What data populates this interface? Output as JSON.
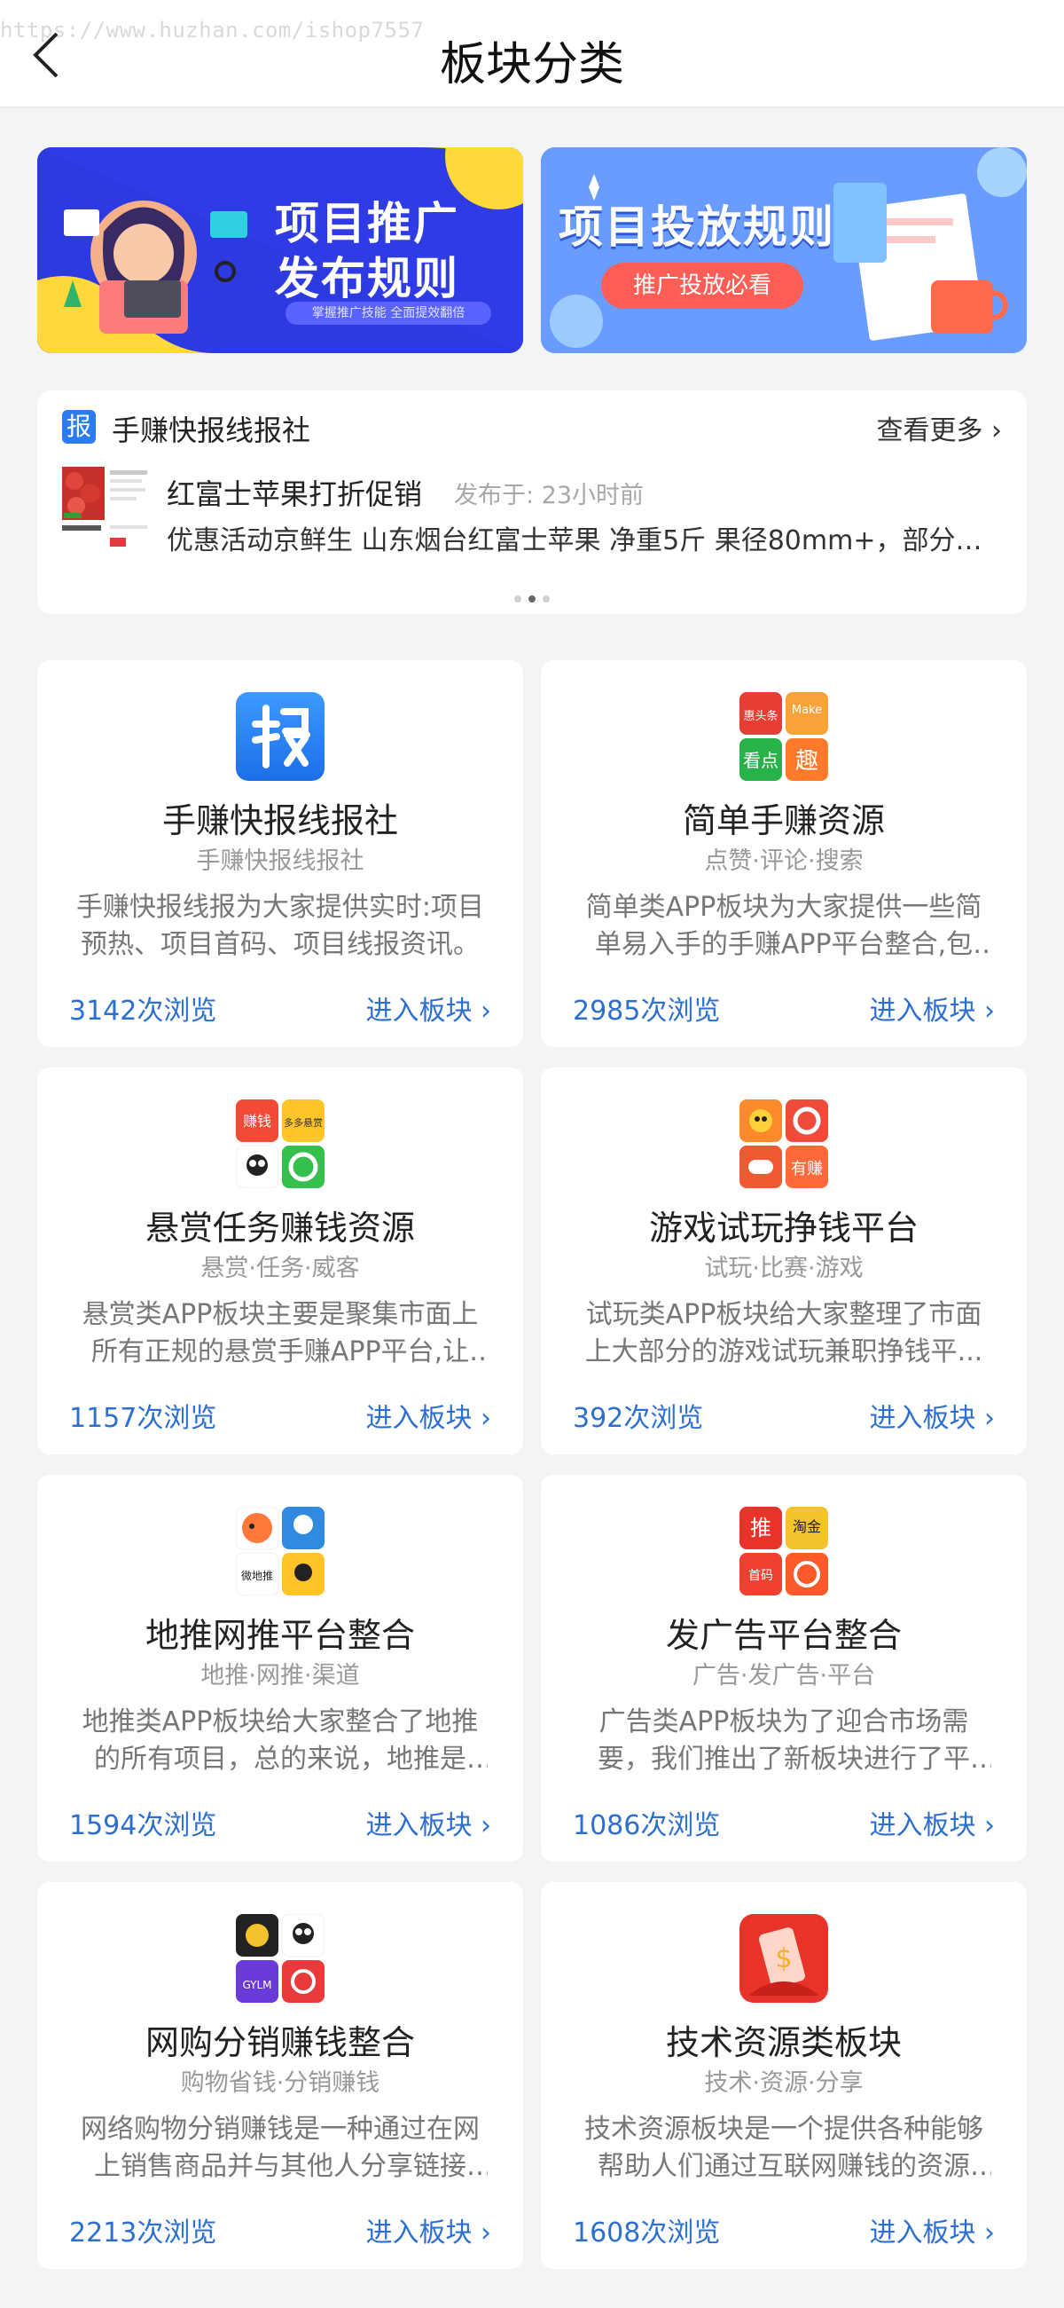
{
  "header": {
    "watermark": "https://www.huzhan.com/ishop7557",
    "title": "板块分类"
  },
  "banners": [
    {
      "title": "项目推广发布规则",
      "line1": "项目推广",
      "line2": "发布规则",
      "tagline": "掌握推广技能 全面提效翻倍"
    },
    {
      "title": "项目投放规则",
      "pill": "推广投放必看"
    }
  ],
  "news": {
    "badge": "报",
    "section_title": "手赚快报线报社",
    "more_label": "查看更多",
    "item": {
      "title": "红富士苹果打折促销",
      "time": "发布于: 23小时前",
      "desc": "优惠活动京鲜生 山东烟台红富士苹果 净重5斤 果径80mm+，部分用..."
    }
  },
  "cards": [
    {
      "name": "手赚快报线报社",
      "sub": "手赚快报线报社",
      "desc": "手赚快报线报为大家提供实时:项目预热、项目首码、项目线报资讯。",
      "views": "3142次浏览",
      "enter": "进入板块"
    },
    {
      "name": "简单手赚资源",
      "sub": "点赞·评论·搜索",
      "desc": "简单类APP板块为大家提供一些简单易入手的手赚APP平台整合,包括...",
      "views": "2985次浏览",
      "enter": "进入板块"
    },
    {
      "name": "悬赏任务赚钱资源",
      "sub": "悬赏·任务·威客",
      "desc": "悬赏类APP板块主要是聚集市面上所有正规的悬赏手赚APP平台,让大...",
      "views": "1157次浏览",
      "enter": "进入板块"
    },
    {
      "name": "游戏试玩挣钱平台",
      "sub": "试玩·比赛·游戏",
      "desc": "试玩类APP板块给大家整理了市面上大部分的游戏试玩兼职挣钱平...",
      "views": "392次浏览",
      "enter": "进入板块"
    },
    {
      "name": "地推网推平台整合",
      "sub": "地推·网推·渠道",
      "desc": "地推类APP板块给大家整合了地推的所有项目，总的来说，地推是一...",
      "views": "1594次浏览",
      "enter": "进入板块"
    },
    {
      "name": "发广告平台整合",
      "sub": "广告·发广告·平台",
      "desc": "广告类APP板块为了迎合市场需要，我们推出了新板块进行了平台...",
      "views": "1086次浏览",
      "enter": "进入板块"
    },
    {
      "name": "网购分销赚钱整合",
      "sub": "购物省钱·分销赚钱",
      "desc": "网络购物分销赚钱是一种通过在网上销售商品并与其他人分享链接来...",
      "views": "2213次浏览",
      "enter": "进入板块"
    },
    {
      "name": "技术资源类板块",
      "sub": "技术·资源·分享",
      "desc": "技术资源板块是一个提供各种能够帮助人们通过互联网赚钱的资源和...",
      "views": "1608次浏览",
      "enter": "进入板块"
    }
  ],
  "icon_labels": {
    "c2": [
      "惠头条",
      "Make",
      "看点",
      "趣"
    ],
    "c3": [
      "赚钱",
      "多多悬赏"
    ],
    "c4": [
      "有赚"
    ],
    "c5": [
      "微地推"
    ],
    "c6": [
      "推",
      "淘金",
      "首码"
    ],
    "c7": [
      "GYLM"
    ]
  },
  "colors": {
    "accent": "#2c6fcf",
    "badge": "#2b7cf0",
    "banner1_bg": "#2d3ae0",
    "banner_yellow": "#ffd83a"
  }
}
